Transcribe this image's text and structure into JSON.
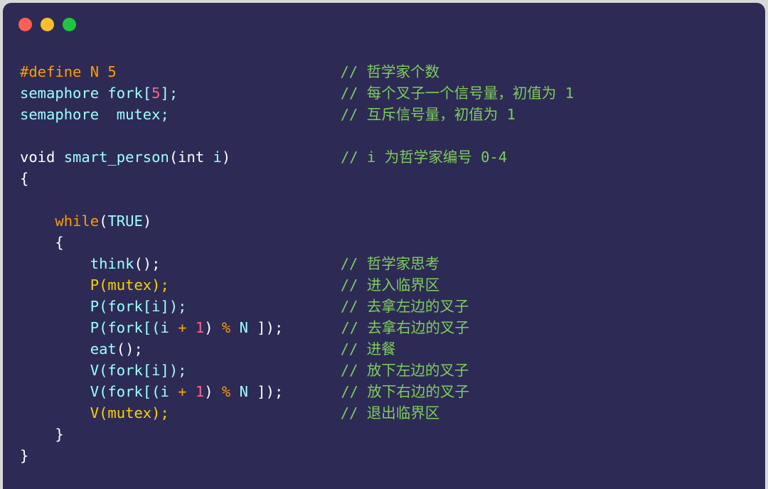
{
  "window": {
    "titlebar": {
      "close_label": "close",
      "minimize_label": "minimize",
      "maximize_label": "maximize"
    },
    "theme": {
      "background": "#2D2B55",
      "comment": "#7FCC5C",
      "keyword": "#FF9D00",
      "function": "#9EFFFF",
      "number": "#FF628C",
      "plain": "#FFFFFF",
      "mutex": "#FAD000",
      "dot_red": "#FF5F52",
      "dot_yellow": "#FFBD2E",
      "dot_green": "#22C53E"
    }
  },
  "code": {
    "lines": [
      {
        "id": "line-define-n",
        "tokens": [
          {
            "t": "#define N 5",
            "c": "pre"
          }
        ],
        "comment": "// 哲学家个数",
        "comment_col": 450
      },
      {
        "id": "line-semaphore-fork",
        "tokens": [
          {
            "t": "semaphore fork[",
            "c": "fn"
          },
          {
            "t": "5",
            "c": "num"
          },
          {
            "t": "]",
            "c": "fn"
          },
          {
            "t": ";",
            "c": "fn"
          }
        ],
        "comment": "// 每个叉子一个信号量，初值为 1",
        "comment_col": 450
      },
      {
        "id": "line-semaphore-mutex",
        "tokens": [
          {
            "t": "semaphore  mutex;",
            "c": "fn"
          }
        ],
        "comment": "// 互斥信号量，初值为 1",
        "comment_col": 450
      },
      {
        "id": "line-blank-1",
        "tokens": [],
        "comment": "",
        "comment_col": 0
      },
      {
        "id": "line-func-signature",
        "tokens": [
          {
            "t": "void ",
            "c": "pln"
          },
          {
            "t": "smart_person",
            "c": "fn"
          },
          {
            "t": "(",
            "c": "pln"
          },
          {
            "t": "int ",
            "c": "pln"
          },
          {
            "t": "i",
            "c": "var"
          },
          {
            "t": ")",
            "c": "pln"
          }
        ],
        "comment": "// i 为哲学家编号 0-4",
        "comment_col": 450
      },
      {
        "id": "line-func-open-brace",
        "tokens": [
          {
            "t": "{",
            "c": "pln"
          }
        ],
        "comment": "",
        "comment_col": 0
      },
      {
        "id": "line-blank-2",
        "tokens": [],
        "comment": "",
        "comment_col": 0
      },
      {
        "id": "line-while",
        "tokens": [
          {
            "t": "    ",
            "c": "pln"
          },
          {
            "t": "while",
            "c": "kw"
          },
          {
            "t": "(",
            "c": "pln"
          },
          {
            "t": "TRUE",
            "c": "fn"
          },
          {
            "t": ")",
            "c": "pln"
          }
        ],
        "comment": "",
        "comment_col": 0
      },
      {
        "id": "line-while-open-brace",
        "tokens": [
          {
            "t": "    {",
            "c": "pln"
          }
        ],
        "comment": "",
        "comment_col": 0
      },
      {
        "id": "line-think",
        "tokens": [
          {
            "t": "        ",
            "c": "pln"
          },
          {
            "t": "think",
            "c": "fn"
          },
          {
            "t": "();",
            "c": "pln"
          }
        ],
        "comment": "// 哲学家思考",
        "comment_col": 450
      },
      {
        "id": "line-p-mutex",
        "tokens": [
          {
            "t": "        ",
            "c": "pln"
          },
          {
            "t": "P(mutex);",
            "c": "mtx"
          }
        ],
        "comment": "// 进入临界区",
        "comment_col": 450
      },
      {
        "id": "line-p-fork-left",
        "tokens": [
          {
            "t": "        ",
            "c": "pln"
          },
          {
            "t": "P(fork[i]);",
            "c": "fn"
          }
        ],
        "comment": "// 去拿左边的叉子",
        "comment_col": 450
      },
      {
        "id": "line-p-fork-right",
        "tokens": [
          {
            "t": "        ",
            "c": "pln"
          },
          {
            "t": "P(fork[(",
            "c": "fn"
          },
          {
            "t": "i ",
            "c": "var"
          },
          {
            "t": "+ ",
            "c": "op"
          },
          {
            "t": "1",
            "c": "num"
          },
          {
            "t": ") ",
            "c": "pln"
          },
          {
            "t": "% ",
            "c": "op"
          },
          {
            "t": "N ",
            "c": "fn"
          },
          {
            "t": "]);",
            "c": "pln"
          }
        ],
        "comment": "// 去拿右边的叉子",
        "comment_col": 450
      },
      {
        "id": "line-eat",
        "tokens": [
          {
            "t": "        ",
            "c": "pln"
          },
          {
            "t": "eat",
            "c": "fn"
          },
          {
            "t": "();",
            "c": "pln"
          }
        ],
        "comment": "// 进餐",
        "comment_col": 450
      },
      {
        "id": "line-v-fork-left",
        "tokens": [
          {
            "t": "        ",
            "c": "pln"
          },
          {
            "t": "V(fork[i]);",
            "c": "fn"
          }
        ],
        "comment": "// 放下左边的叉子",
        "comment_col": 450
      },
      {
        "id": "line-v-fork-right",
        "tokens": [
          {
            "t": "        ",
            "c": "pln"
          },
          {
            "t": "V(fork[(",
            "c": "fn"
          },
          {
            "t": "i ",
            "c": "var"
          },
          {
            "t": "+ ",
            "c": "op"
          },
          {
            "t": "1",
            "c": "num"
          },
          {
            "t": ") ",
            "c": "pln"
          },
          {
            "t": "% ",
            "c": "op"
          },
          {
            "t": "N ",
            "c": "fn"
          },
          {
            "t": "]);",
            "c": "pln"
          }
        ],
        "comment": "// 放下右边的叉子",
        "comment_col": 450
      },
      {
        "id": "line-v-mutex",
        "tokens": [
          {
            "t": "        ",
            "c": "pln"
          },
          {
            "t": "V(mutex);",
            "c": "mtx"
          }
        ],
        "comment": "// 退出临界区",
        "comment_col": 450
      },
      {
        "id": "line-while-close-brace",
        "tokens": [
          {
            "t": "    }",
            "c": "pln"
          }
        ],
        "comment": "",
        "comment_col": 0
      },
      {
        "id": "line-func-close-brace",
        "tokens": [
          {
            "t": "}",
            "c": "pln"
          }
        ],
        "comment": "",
        "comment_col": 0
      }
    ]
  }
}
